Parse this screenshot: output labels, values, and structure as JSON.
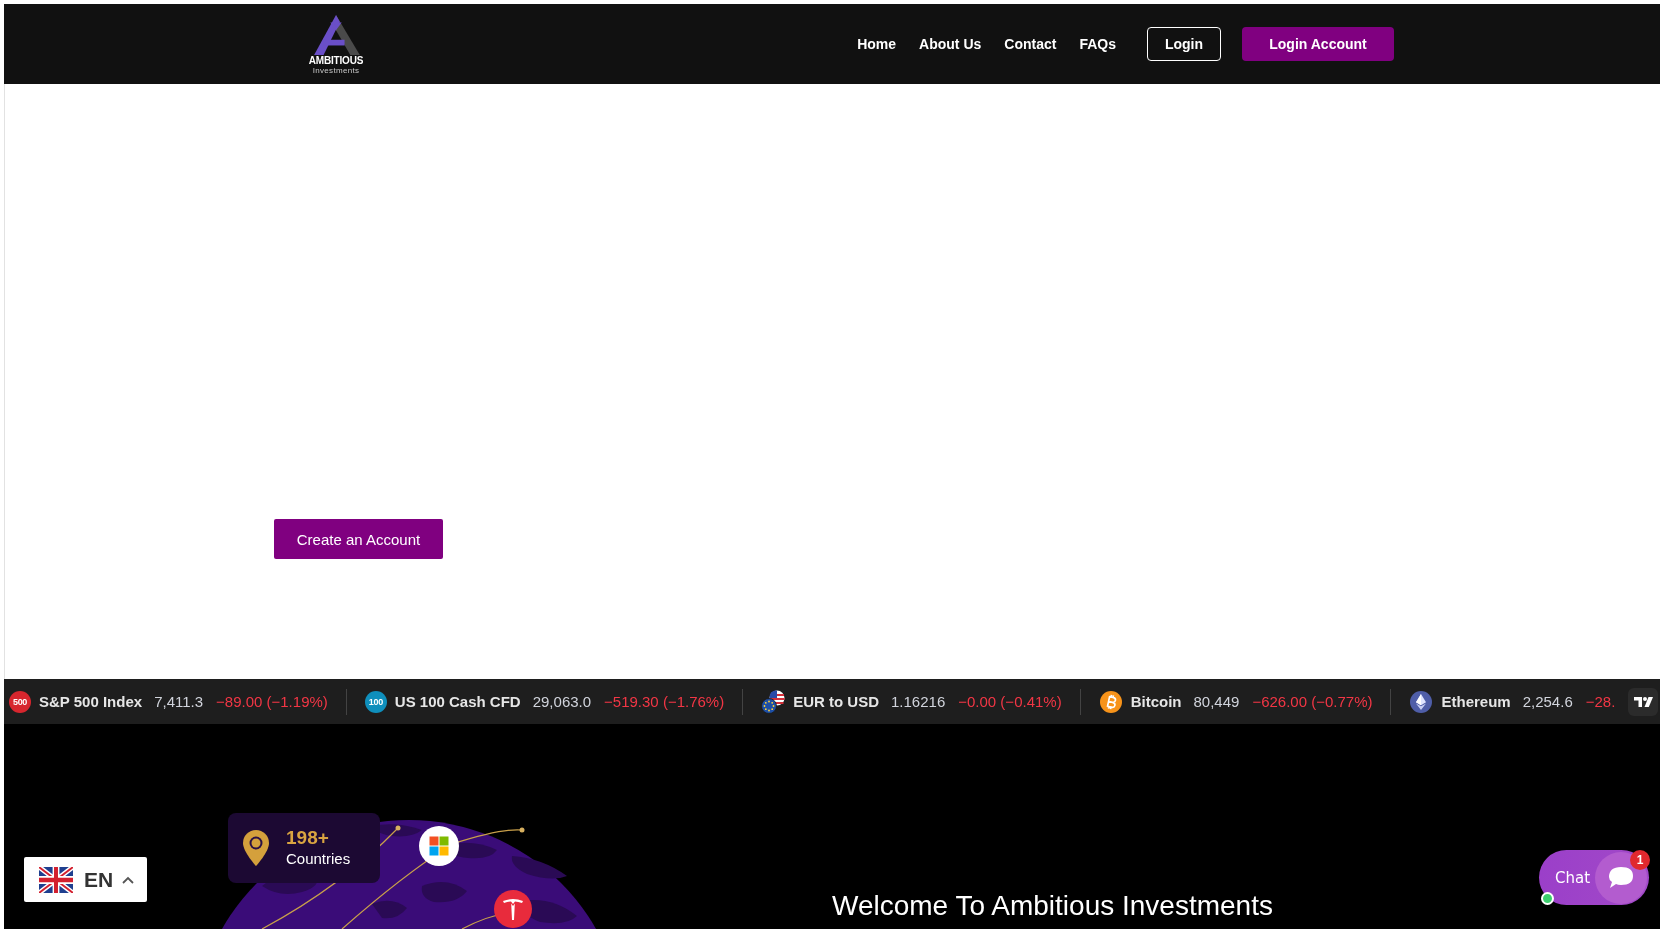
{
  "header": {
    "logo": {
      "wordmark": "AMBITIOUS",
      "tagline": "Investments"
    },
    "nav": [
      {
        "label": "Home"
      },
      {
        "label": "About Us"
      },
      {
        "label": "Contact"
      },
      {
        "label": "FAQs"
      }
    ],
    "buttons": [
      {
        "label": "Login",
        "kind": "outline"
      },
      {
        "label": "Login Account",
        "kind": "filled"
      }
    ]
  },
  "hero": {
    "button": "Create an Account"
  },
  "ticker": {
    "items": [
      {
        "kind": "badge",
        "icon_text": "500",
        "color": "#d7262e",
        "name": "S&P 500 Index",
        "price": "7,411.3",
        "change": "−89.00 (−1.19%)",
        "falling": true
      },
      {
        "kind": "badge",
        "icon_text": "100",
        "color": "#0f8fbc",
        "name": "US 100 Cash CFD",
        "price": "29,063.0",
        "change": "−519.30 (−1.76%)",
        "falling": true
      },
      {
        "kind": "flags",
        "name": "EUR to USD",
        "price": "1.16216",
        "change": "−0.00 (−0.41%)",
        "falling": true
      },
      {
        "kind": "bitcoin",
        "color": "#f7931a",
        "name": "Bitcoin",
        "price": "80,449",
        "change": "−626.00 (−0.77%)",
        "falling": true
      },
      {
        "kind": "ethereum",
        "color": "#4f5ea8",
        "name": "Ethereum",
        "price": "2,254.6",
        "change": "−28.",
        "falling": true
      }
    ]
  },
  "showcase": {
    "stat": {
      "value": "198+",
      "label": "Countries"
    },
    "title": "Welcome To Ambitious Investments"
  },
  "language": {
    "code": "EN"
  },
  "chat": {
    "label": "Chat",
    "badge": "1",
    "online": true
  }
}
